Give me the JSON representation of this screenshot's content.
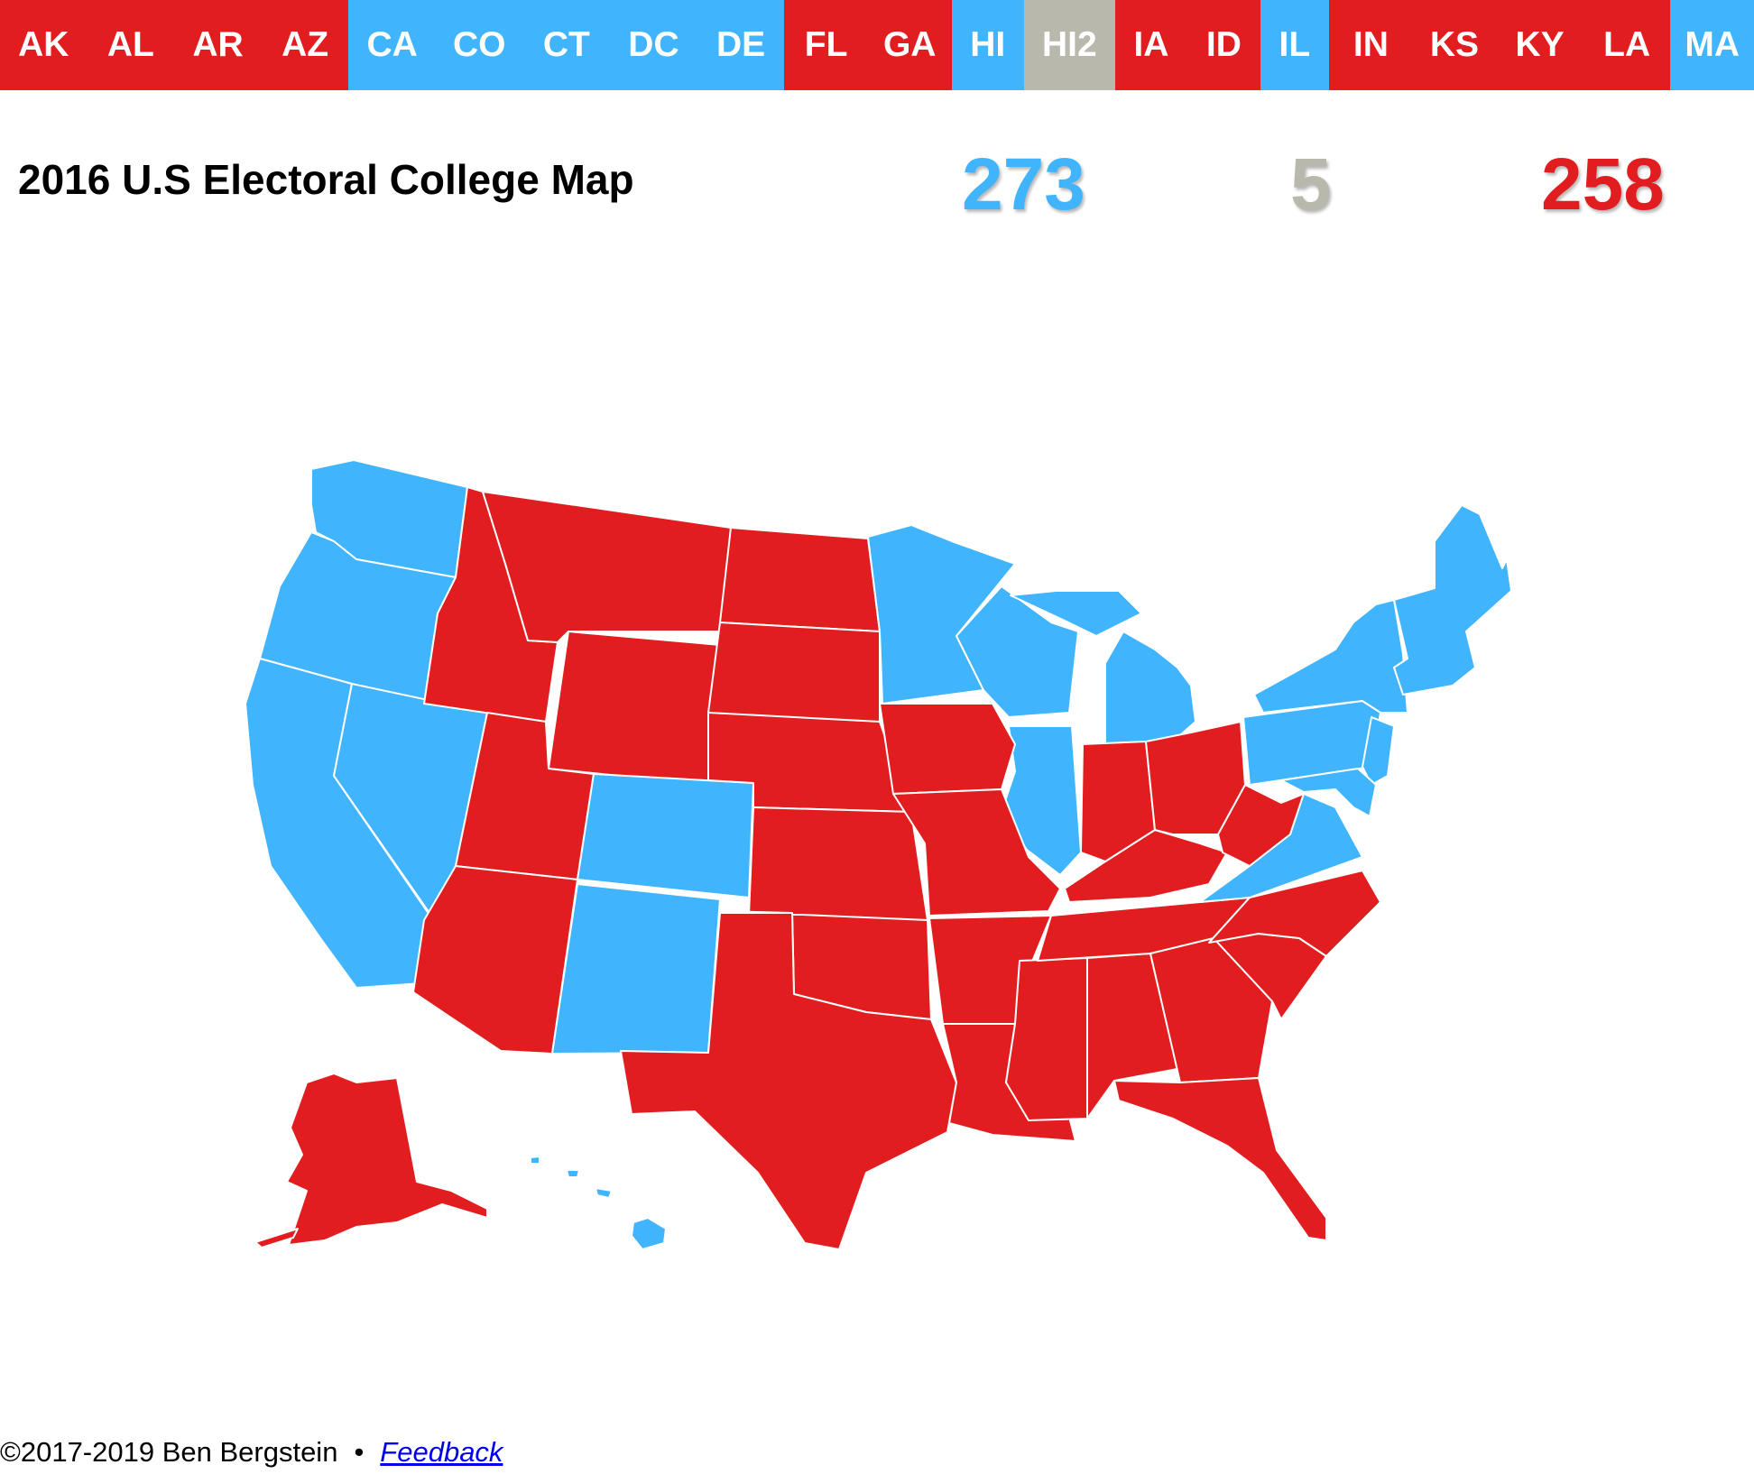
{
  "colors": {
    "dem": "#40b4fc",
    "rep": "#e21d1f",
    "other": "#b8b8ac",
    "white": "#ffffff"
  },
  "tabs": [
    {
      "label": "AK",
      "party": "rep"
    },
    {
      "label": "AL",
      "party": "rep"
    },
    {
      "label": "AR",
      "party": "rep"
    },
    {
      "label": "AZ",
      "party": "rep"
    },
    {
      "label": "CA",
      "party": "dem"
    },
    {
      "label": "CO",
      "party": "dem"
    },
    {
      "label": "CT",
      "party": "dem"
    },
    {
      "label": "DC",
      "party": "dem"
    },
    {
      "label": "DE",
      "party": "dem"
    },
    {
      "label": "FL",
      "party": "rep"
    },
    {
      "label": "GA",
      "party": "rep"
    },
    {
      "label": "HI",
      "party": "dem"
    },
    {
      "label": "HI2",
      "party": "other"
    },
    {
      "label": "IA",
      "party": "rep"
    },
    {
      "label": "ID",
      "party": "rep"
    },
    {
      "label": "IL",
      "party": "dem"
    },
    {
      "label": "IN",
      "party": "rep"
    },
    {
      "label": "KS",
      "party": "rep"
    },
    {
      "label": "KY",
      "party": "rep"
    },
    {
      "label": "LA",
      "party": "rep"
    },
    {
      "label": "MA",
      "party": "dem"
    }
  ],
  "header": {
    "title": "2016 U.S Electoral College Map",
    "dem_votes": "273",
    "other_votes": "5",
    "rep_votes": "258"
  },
  "footer": {
    "copyright": "©2017-2019 Ben Bergstein",
    "separator": "•",
    "feedback_label": "Feedback"
  }
}
